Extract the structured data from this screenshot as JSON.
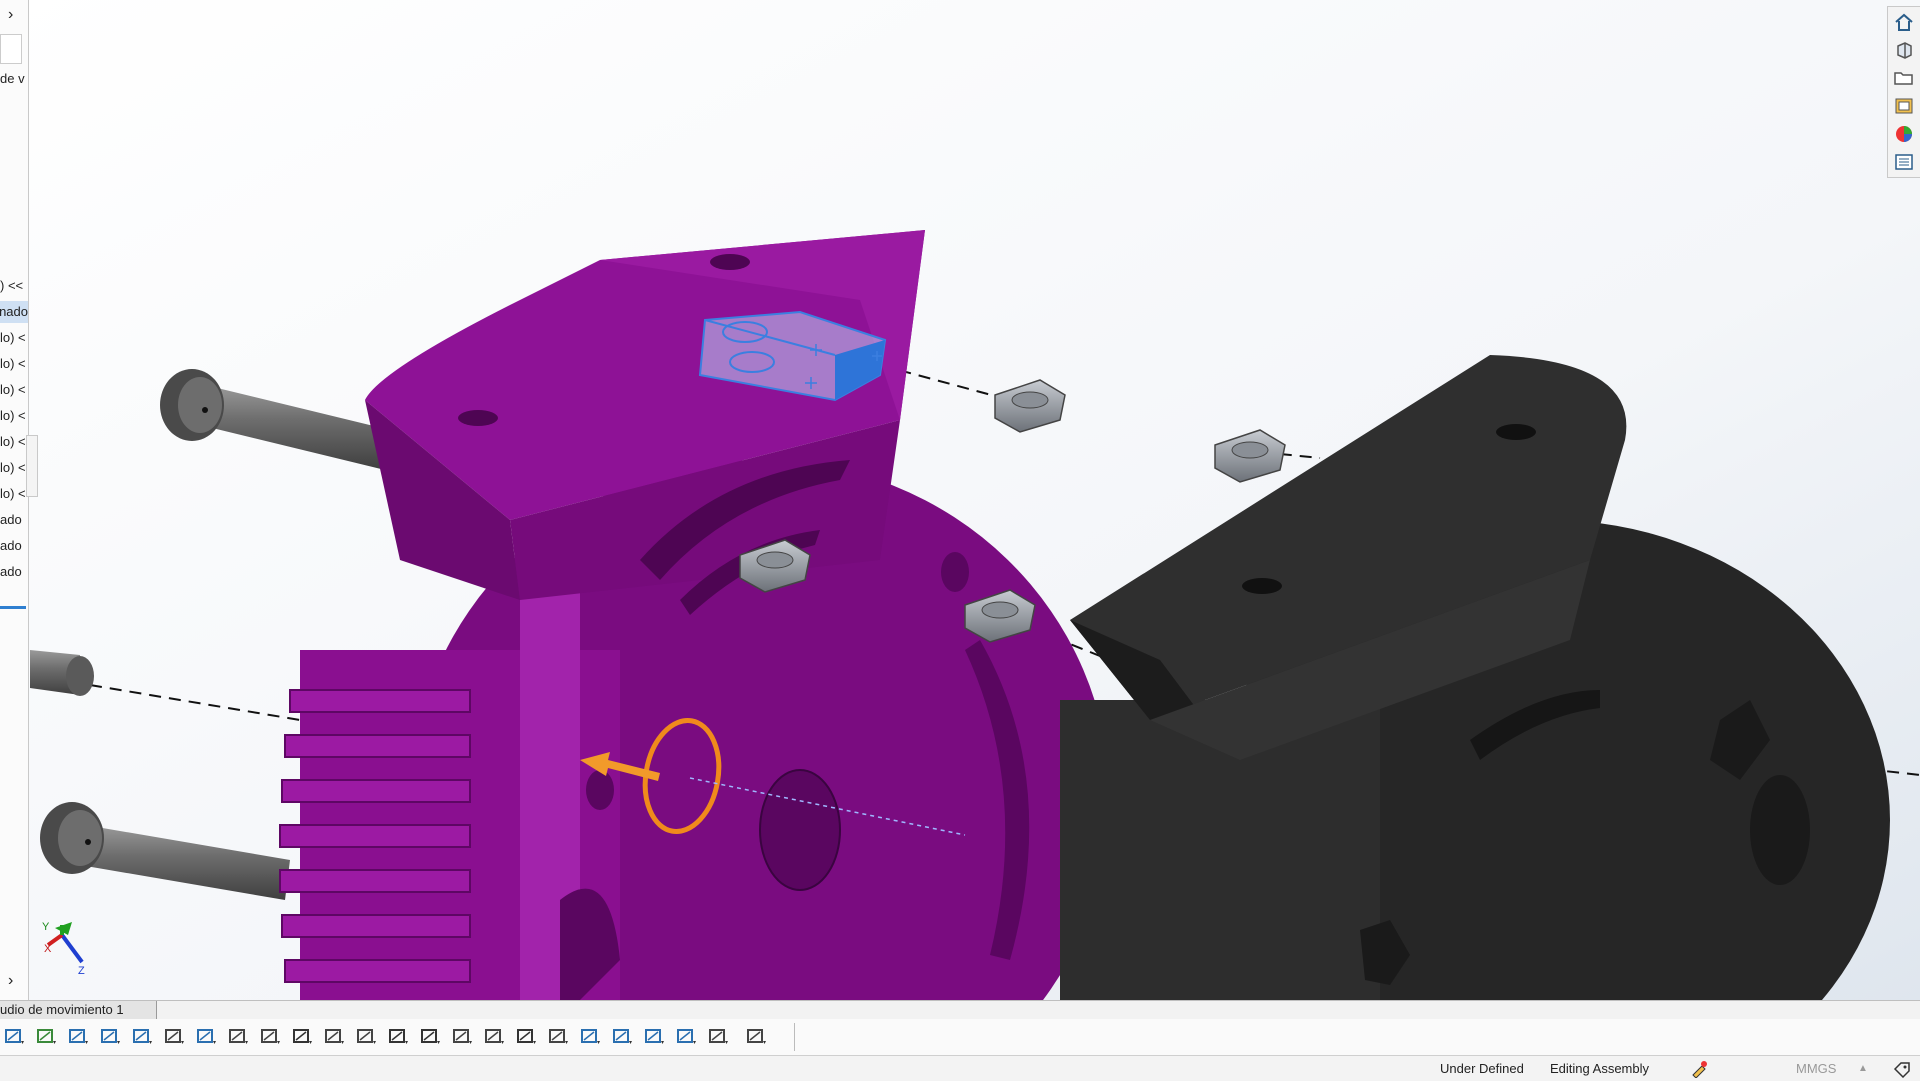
{
  "left_panel": {
    "fragment_top": "de v",
    "tree_rows": [
      {
        "text": ") <<",
        "selected": false
      },
      {
        "text": "nado",
        "selected": true
      },
      {
        "text": "lo) <",
        "selected": false
      },
      {
        "text": "lo) <",
        "selected": false
      },
      {
        "text": "lo) <",
        "selected": false
      },
      {
        "text": "lo) <",
        "selected": false
      },
      {
        "text": "lo) <",
        "selected": false
      },
      {
        "text": "lo) <",
        "selected": false
      },
      {
        "text": "lo) <",
        "selected": false
      },
      {
        "text": "ado",
        "selected": false
      },
      {
        "text": "ado",
        "selected": false
      },
      {
        "text": "ado",
        "selected": false
      }
    ]
  },
  "heads_up_icons": [
    "home-view-icon",
    "view-orientation-icon",
    "open-folder-icon",
    "design-library-icon",
    "appearances-icon",
    "custom-properties-icon"
  ],
  "triad_labels": {
    "x": "X",
    "y": "Y",
    "z": "Z"
  },
  "tabs": {
    "motion_study": "udio de movimiento 1"
  },
  "toolbar_icons": [
    "smart-mate-icon",
    "linear-pattern-icon",
    "insert-component-icon",
    "mate-icon",
    "edge-icon",
    "sketch-icon",
    "line-icon",
    "grid-icon",
    "bend-icon",
    "check-icon",
    "table-icon",
    "search-icon",
    "text-icon",
    "curve-icon",
    "pattern-icon",
    "zoom-icon",
    "filter-icon",
    "annotation-icon",
    "sphere-icon",
    "align-left-icon",
    "align-right-icon",
    "image-icon",
    "arrow-up-icon",
    "arrow-down-icon"
  ],
  "status": {
    "definition": "Under Defined",
    "mode": "Editing Assembly",
    "units": "MMGS"
  },
  "colors": {
    "part_purple": "#8a0f90",
    "part_black": "#2a2a2a",
    "selection_blue": "#3b7fe0",
    "manipulator_orange": "#f08a1c"
  }
}
